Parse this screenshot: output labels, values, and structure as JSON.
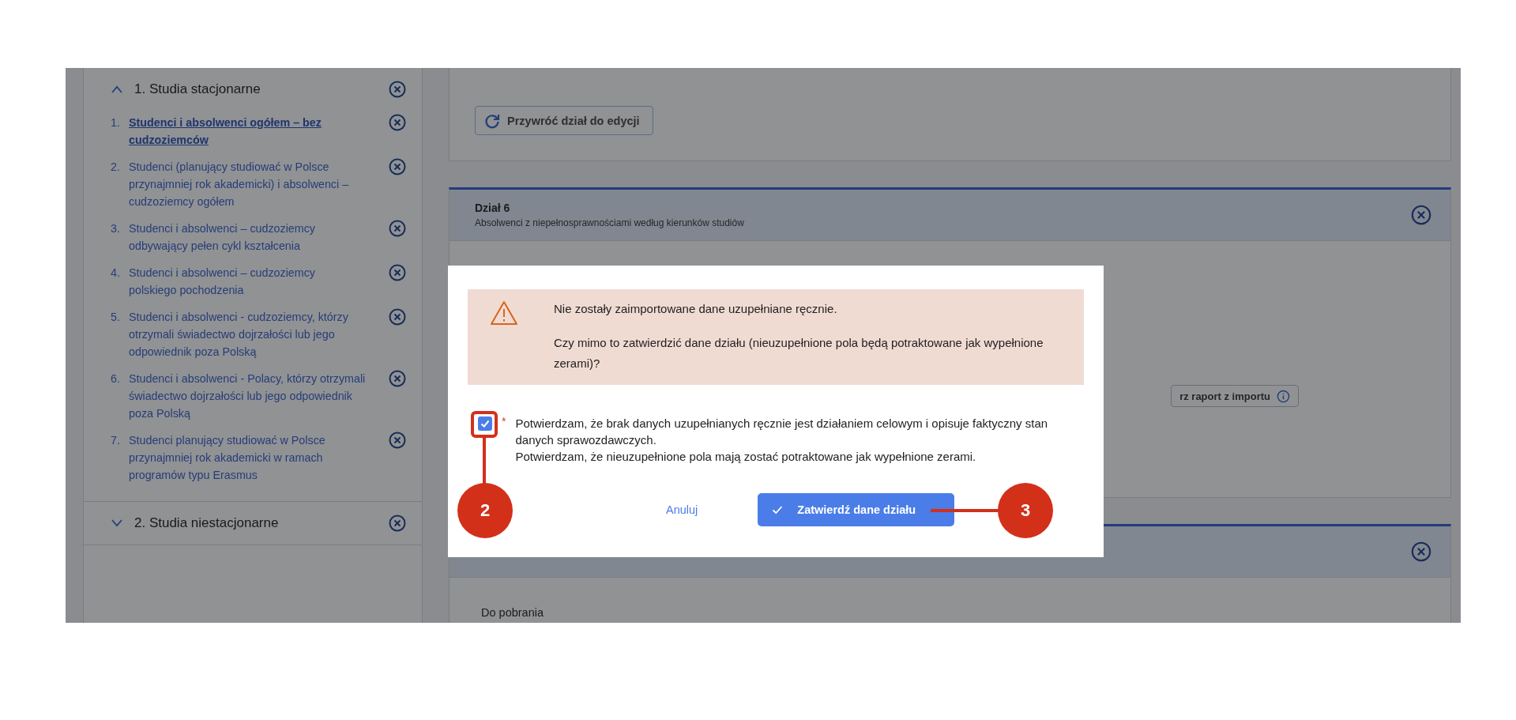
{
  "sidebar": {
    "sections": [
      {
        "title": "1. Studia stacjonarne",
        "expanded": true,
        "items": [
          {
            "number": "1.",
            "label": "Studenci i absolwenci ogółem – bez cudzoziemców",
            "selected": true
          },
          {
            "number": "2.",
            "label": "Studenci (planujący studiować w Polsce przynajmniej rok akademicki) i absolwenci – cudzoziemcy ogółem",
            "selected": false
          },
          {
            "number": "3.",
            "label": "Studenci i absolwenci – cudzoziemcy odbywający pełen cykl kształcenia",
            "selected": false
          },
          {
            "number": "4.",
            "label": "Studenci i absolwenci – cudzoziemcy polskiego pochodzenia",
            "selected": false
          },
          {
            "number": "5.",
            "label": "Studenci i absolwenci - cudzoziemcy, którzy otrzymali świadectwo dojrzałości lub jego odpowiednik poza Polską",
            "selected": false
          },
          {
            "number": "6.",
            "label": "Studenci i absolwenci - Polacy, którzy otrzymali świadectwo dojrzałości lub jego odpowiednik poza Polską",
            "selected": false
          },
          {
            "number": "7.",
            "label": "Studenci planujący studiować w Polsce przynajmniej rok akademicki w ramach programów typu Erasmus",
            "selected": false
          }
        ]
      },
      {
        "title": "2. Studia niestacjonarne",
        "expanded": false
      }
    ]
  },
  "main": {
    "restore_button": "Przywróć dział do edycji",
    "sections": [
      {
        "title": "Dział 6",
        "subtitle": "Absolwenci z niepełnosprawnościami według kierunków studiów",
        "report_button": "rz raport z importu"
      },
      {
        "content_label": "Do pobrania"
      }
    ]
  },
  "dialog": {
    "alert": {
      "kind": "warning",
      "lines": [
        "Nie zostały zaimportowane dane uzupełniane ręcznie.",
        "Czy mimo to zatwierdzić dane działu (nieuzupełnione pola będą potraktowane jak wypełnione zerami)?"
      ]
    },
    "confirmation": {
      "checked": true,
      "required_mark": "*",
      "lines": [
        "Potwierdzam, że brak danych uzupełnianych ręcznie jest działaniem celowym i opisuje faktyczny stan danych sprawozdawczych.",
        "Potwierdzam, że nieuzupełnione pola mają zostać potraktowane jak wypełnione zerami."
      ]
    },
    "cancel_button": "Anuluj",
    "confirm_button": "Zatwierdź dane działu"
  },
  "annotations": [
    {
      "label": "2",
      "kind": "vertical"
    },
    {
      "label": "3",
      "kind": "horizontal"
    }
  ]
}
